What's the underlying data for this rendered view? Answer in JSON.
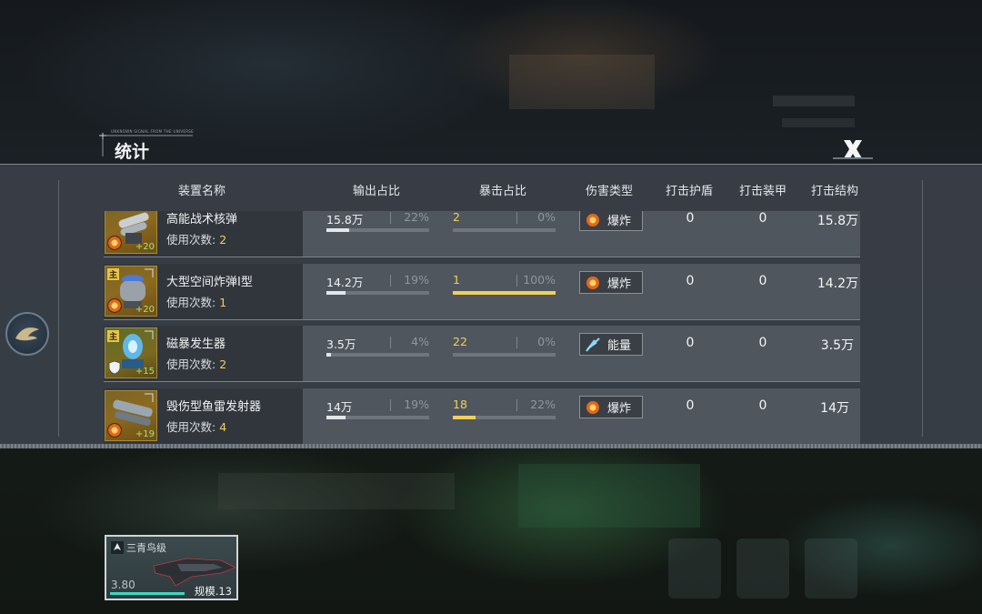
{
  "header": {
    "subtitle": "UNKNOWN SIGNAL FROM THE UNIVERSE",
    "title": "统计",
    "close_icon": "close-x-icon"
  },
  "columns": [
    "装置名称",
    "输出占比",
    "暴击占比",
    "伤害类型",
    "打击护盾",
    "打击装甲",
    "打击结构"
  ],
  "rows": [
    {
      "name": "高能战术核弹",
      "uses_label": "使用次数: ",
      "uses": "2",
      "main_tag": "",
      "plus": "+20",
      "output_value": "15.8万",
      "output_pct": "22%",
      "output_fraction": 0.22,
      "crit_value": "2",
      "crit_pct": "0%",
      "crit_fraction": 0.0,
      "damage_type": "爆炸",
      "damage_icon": "explosion-icon",
      "shield": "0",
      "armor": "0",
      "structure": "15.8万"
    },
    {
      "name": "大型空间炸弹I型",
      "uses_label": "使用次数: ",
      "uses": "1",
      "main_tag": "主",
      "plus": "+20",
      "output_value": "14.2万",
      "output_pct": "19%",
      "output_fraction": 0.19,
      "crit_value": "1",
      "crit_pct": "100%",
      "crit_fraction": 1.0,
      "damage_type": "爆炸",
      "damage_icon": "explosion-icon",
      "shield": "0",
      "armor": "0",
      "structure": "14.2万"
    },
    {
      "name": "磁暴发生器",
      "uses_label": "使用次数: ",
      "uses": "2",
      "main_tag": "主",
      "plus": "+15",
      "output_value": "3.5万",
      "output_pct": "4%",
      "output_fraction": 0.04,
      "crit_value": "22",
      "crit_pct": "0%",
      "crit_fraction": 0.0,
      "damage_type": "能量",
      "damage_icon": "energy-icon",
      "shield": "0",
      "armor": "0",
      "structure": "3.5万"
    },
    {
      "name": "毁伤型鱼雷发射器",
      "uses_label": "使用次数: ",
      "uses": "4",
      "main_tag": "",
      "plus": "+19",
      "output_value": "14万",
      "output_pct": "19%",
      "output_fraction": 0.19,
      "crit_value": "18",
      "crit_pct": "22%",
      "crit_fraction": 0.22,
      "damage_type": "爆炸",
      "damage_icon": "explosion-icon",
      "shield": "0",
      "armor": "0",
      "structure": "14万"
    }
  ],
  "ship_card": {
    "class_name": "三青鸟级",
    "power": "3.80",
    "scale": "规模.13"
  },
  "colors": {
    "accent_yellow": "#f2cf5a",
    "panel": "#3a4048",
    "hp_teal": "#3fd8c0"
  }
}
